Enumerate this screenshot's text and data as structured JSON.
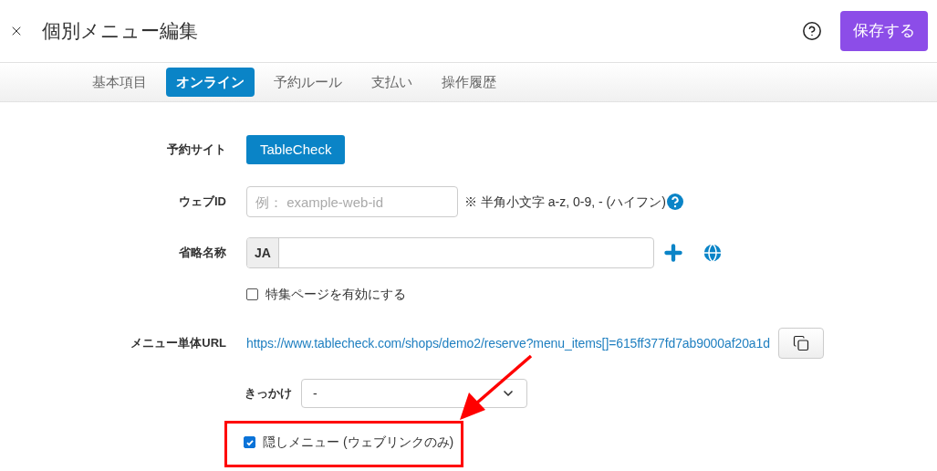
{
  "header": {
    "title": "個別メニュー編集",
    "save_button": "保存する"
  },
  "tabs": [
    {
      "label": "基本項目",
      "selected": false
    },
    {
      "label": "オンライン",
      "selected": true
    },
    {
      "label": "予約ルール",
      "selected": false
    },
    {
      "label": "支払い",
      "selected": false
    },
    {
      "label": "操作履歴",
      "selected": false
    }
  ],
  "form": {
    "reservation_site": {
      "label": "予約サイト",
      "value": "TableCheck"
    },
    "web_id": {
      "label": "ウェブID",
      "placeholder": "例： example-web-id",
      "note": "※ 半角小文字 a-z, 0-9, - (ハイフン)"
    },
    "short_name": {
      "label": "省略名称",
      "language": "JA"
    },
    "feature_page": {
      "label": "特集ページを有効にする",
      "checked": false
    },
    "menu_url": {
      "label": "メニュー単体URL",
      "url": "https://www.tablecheck.com/shops/demo2/reserve?menu_items[]=615ff377fd7ab9000af20a1d"
    },
    "trigger": {
      "label": "きっかけ",
      "value": "-"
    },
    "hidden_menu": {
      "label": "隠しメニュー (ウェブリンクのみ)",
      "checked": true
    }
  }
}
